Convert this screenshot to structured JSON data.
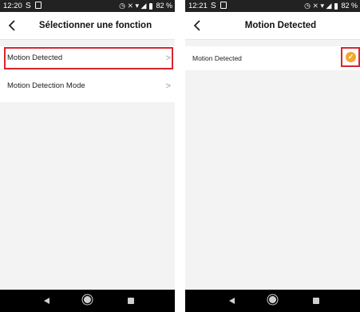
{
  "left_screen": {
    "status": {
      "time": "12:20",
      "left_icons": "S",
      "battery": "82 %",
      "right_icons": "◷ ⨯ ▾ ◢"
    },
    "title": "Sélectionner une fonction",
    "items": [
      {
        "label": "Motion Detected",
        "highlighted": true
      },
      {
        "label": "Motion Detection Mode",
        "highlighted": false
      }
    ]
  },
  "right_screen": {
    "status": {
      "time": "12:21",
      "left_icons": "S",
      "battery": "82 %",
      "right_icons": "◷ ⨯ ▾ ◢"
    },
    "title": "Motion Detected",
    "option": {
      "label": "Motion Detected",
      "checked": true,
      "check_color": "#f4a72a"
    }
  },
  "colors": {
    "highlight": "#d7262e",
    "accent": "#f4a72a"
  }
}
